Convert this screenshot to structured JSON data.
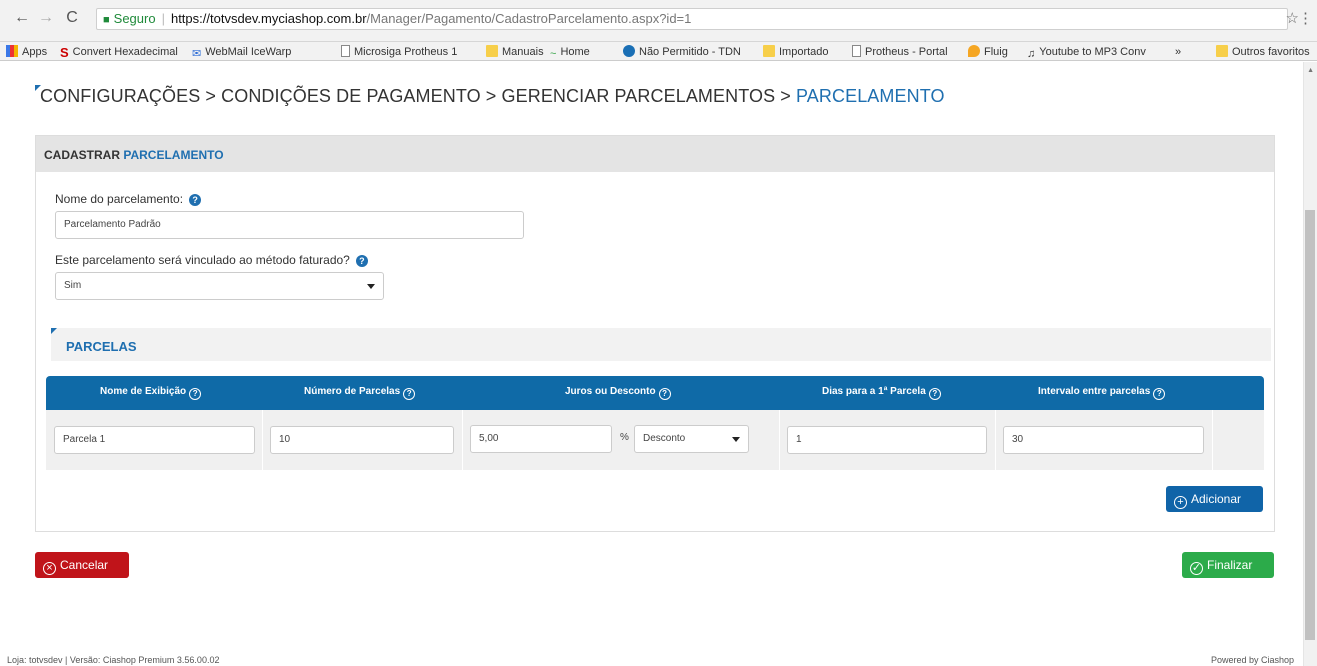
{
  "browser": {
    "url_secure_label": "Seguro",
    "url_host": "https://totvsdev.myciashop.com.br",
    "url_path": "/Manager/Pagamento/CadastroParcelamento.aspx?id=1",
    "bookmarks": [
      {
        "label": "Apps",
        "icon": "apps-icon"
      },
      {
        "label": "Convert Hexadecimal",
        "icon": "s-icon"
      },
      {
        "label": "WebMail IceWarp",
        "icon": "mail-icon"
      },
      {
        "label": "Microsiga Protheus 1",
        "icon": "page-icon"
      },
      {
        "label": "Manuais",
        "icon": "folder-icon"
      },
      {
        "label": "Home",
        "icon": "wave-icon"
      },
      {
        "label": "Não Permitido - TDN",
        "icon": "globe-icon"
      },
      {
        "label": "Importado",
        "icon": "folder-icon"
      },
      {
        "label": "Protheus - Portal",
        "icon": "page-icon"
      },
      {
        "label": "Fluig",
        "icon": "fluig-icon"
      },
      {
        "label": "Youtube to MP3 Conv",
        "icon": "music-icon"
      },
      {
        "label": "»",
        "icon": ""
      },
      {
        "label": "Outros favoritos",
        "icon": "folder-icon"
      }
    ]
  },
  "breadcrumb": {
    "path": "CONFIGURAÇÕES > CONDIÇÕES DE PAGAMENTO > GERENCIAR PARCELAMENTOS > ",
    "current": "PARCELAMENTO"
  },
  "panel": {
    "title_prefix": "CADASTRAR",
    "title_highlight": "PARCELAMENTO",
    "name_label": "Nome do parcelamento:",
    "name_value": "Parcelamento Padrão",
    "billed_label": "Este parcelamento será vinculado ao método faturado?",
    "billed_value": "Sim",
    "help_glyph": "?"
  },
  "parcelas": {
    "title": "PARCELAS",
    "columns": [
      "Nome de Exibição",
      "Número de Parcelas",
      "Juros ou Desconto",
      "Dias para a 1ª Parcela",
      "Intervalo entre parcelas"
    ],
    "row": {
      "display_name": "Parcela 1",
      "installments": "10",
      "rate": "5,00",
      "percent": "%",
      "rate_type": "Desconto",
      "first_days": "1",
      "interval": "30"
    },
    "add_label": "Adicionar"
  },
  "actions": {
    "cancel_label": "Cancelar",
    "finish_label": "Finalizar"
  },
  "footer": {
    "left": "Loja: totvsdev | Versão: Ciashop Premium 3.56.00.02",
    "right": "Powered by Ciashop"
  },
  "colors": {
    "accent": "#1f6fb0",
    "table_header": "#0f6aa7",
    "cancel": "#c0141a",
    "finish": "#2cab4a"
  }
}
